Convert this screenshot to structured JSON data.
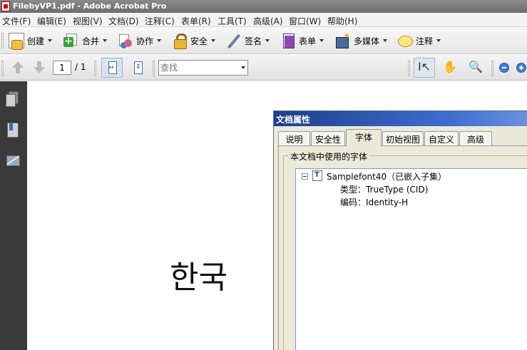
{
  "window": {
    "title": "FilebyVP1.pdf - Adobe Acrobat Pro"
  },
  "menubar": {
    "items": [
      "文件(F)",
      "编辑(E)",
      "视图(V)",
      "文档(D)",
      "注释(C)",
      "表单(R)",
      "工具(T)",
      "高级(A)",
      "窗口(W)",
      "帮助(H)"
    ]
  },
  "toolbar": {
    "create": "创建",
    "combine": "合并",
    "collaborate": "协作",
    "secure": "安全",
    "sign": "签名",
    "forms": "表单",
    "multimedia": "多媒体",
    "comment": "注释"
  },
  "navbar": {
    "current_page": "1",
    "total_pages": "/ 1",
    "find_placeholder": "查找"
  },
  "document": {
    "text": "한국"
  },
  "dialog": {
    "title": "文档属性",
    "tabs": [
      "说明",
      "安全性",
      "字体",
      "初始视图",
      "自定义",
      "高级"
    ],
    "active_tab": "字体",
    "fonts_section_label": "本文档中使用的字体",
    "font": {
      "name": "Samplefont40（已嵌入子集）",
      "type": "类型：TrueType (CID)",
      "encoding": "编码：Identity-H"
    }
  }
}
